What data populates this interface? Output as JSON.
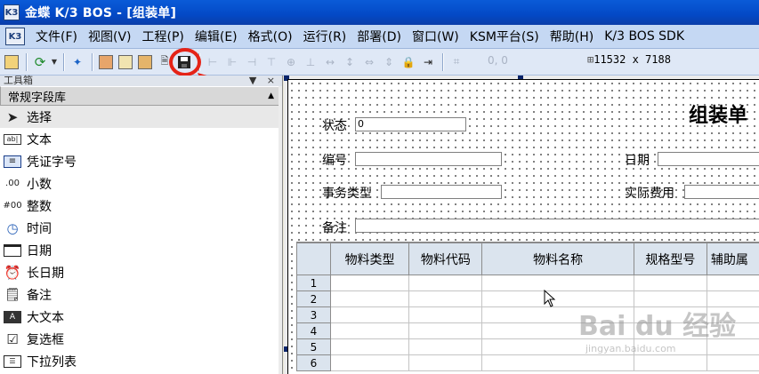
{
  "window": {
    "title": "金蝶 K/3 BOS - [组装单]",
    "app_icon_text": "K3"
  },
  "menubar": {
    "items": [
      "文件(F)",
      "视图(V)",
      "工程(P)",
      "编辑(E)",
      "格式(O)",
      "运行(R)",
      "部署(D)",
      "窗口(W)",
      "KSM平台(S)",
      "帮助(H)",
      "K/3 BOS SDK"
    ]
  },
  "toolbar": {
    "position_readout": "0, 0",
    "size_readout": "11532 x 7188"
  },
  "toolbox": {
    "title": "工具箱",
    "controls": "▼ × ",
    "group": "常规字段库",
    "items": [
      {
        "label": "选择",
        "icon": "pointer-icon"
      },
      {
        "label": "文本",
        "icon": "text-field-icon"
      },
      {
        "label": "凭证字号",
        "icon": "voucher-icon"
      },
      {
        "label": "小数",
        "icon": "decimal-icon"
      },
      {
        "label": "整数",
        "icon": "integer-icon"
      },
      {
        "label": "时间",
        "icon": "clock-icon"
      },
      {
        "label": "日期",
        "icon": "calendar-icon"
      },
      {
        "label": "长日期",
        "icon": "alarm-clock-icon"
      },
      {
        "label": "备注",
        "icon": "note-icon"
      },
      {
        "label": "大文本",
        "icon": "large-text-icon"
      },
      {
        "label": "复选框",
        "icon": "checkbox-icon"
      },
      {
        "label": "下拉列表",
        "icon": "dropdown-list-icon"
      }
    ]
  },
  "form": {
    "title": "组装单",
    "status_label": "状态",
    "status_value": "0",
    "number_label": "编号",
    "date_label": "日期",
    "business_type_label": "事务类型",
    "actual_cost_label": "实际费用",
    "remark_label": "备注"
  },
  "grid": {
    "columns": [
      "",
      "物料类型",
      "物料代码",
      "物料名称",
      "规格型号",
      "辅助属"
    ],
    "rows": [
      "1",
      "2",
      "3",
      "4",
      "5",
      "6"
    ]
  },
  "watermark": {
    "main": "Bai  du 经验",
    "sub": "jingyan.baidu.com"
  }
}
